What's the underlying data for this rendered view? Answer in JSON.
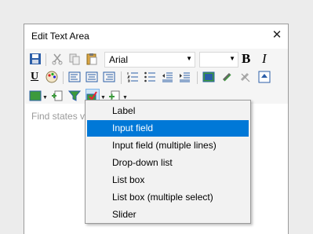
{
  "dialog": {
    "title": "Edit Text Area"
  },
  "toolbar": {
    "font_name": "Arial",
    "font_size": "",
    "bold_label": "B",
    "italic_label": "I",
    "underline_label": "U"
  },
  "editor": {
    "placeholder": "Find states v"
  },
  "menu": {
    "items": [
      {
        "label": "Label",
        "selected": false
      },
      {
        "label": "Input field",
        "selected": true
      },
      {
        "label": "Input field (multiple lines)",
        "selected": false
      },
      {
        "label": "Drop-down list",
        "selected": false
      },
      {
        "label": "List box",
        "selected": false
      },
      {
        "label": "List box (multiple select)",
        "selected": false
      },
      {
        "label": "Slider",
        "selected": false
      }
    ]
  },
  "colors": {
    "selection": "#0078d7",
    "icon_blue": "#2b5ea8",
    "icon_green": "#3c9a3c"
  }
}
